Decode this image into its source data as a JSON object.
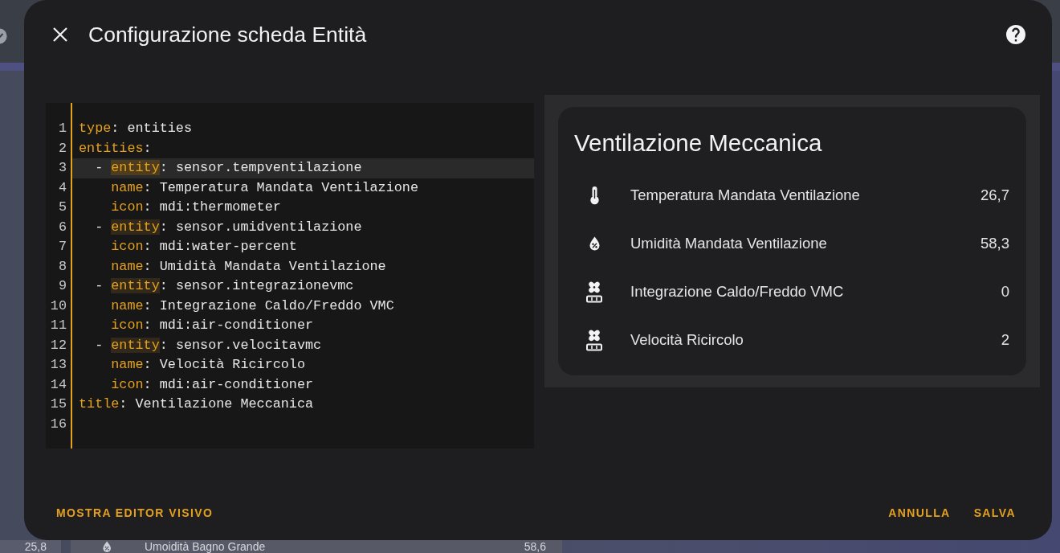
{
  "dashboard": {
    "side_value": "25,8",
    "row": {
      "kind": "humidity",
      "name": "Umoidità Bagno Grande",
      "value": "58,6"
    }
  },
  "dialog": {
    "title": "Configurazione scheda Entità",
    "editor": {
      "lines": [
        {
          "number": "1",
          "active": false,
          "tokens": [
            {
              "kind": "key",
              "text": "type",
              "matched": false
            },
            {
              "kind": "plain",
              "text": ": entities"
            }
          ]
        },
        {
          "number": "2",
          "active": false,
          "tokens": [
            {
              "kind": "key",
              "text": "entities",
              "matched": false
            },
            {
              "kind": "plain",
              "text": ":"
            }
          ],
          "children": [
            {
              "number": "3",
              "active": true,
              "tokens": [
                {
                  "kind": "plain",
                  "text": "- "
                },
                {
                  "kind": "key",
                  "text": "entity",
                  "matched": true
                },
                {
                  "kind": "plain",
                  "text": ": sensor.tempventilazione"
                }
              ],
              "children": [
                {
                  "number": "4",
                  "active": false,
                  "tokens": [
                    {
                      "kind": "key",
                      "text": "name",
                      "matched": false
                    },
                    {
                      "kind": "plain",
                      "text": ": Temperatura Mandata Ventilazione"
                    }
                  ]
                },
                {
                  "number": "5",
                  "active": false,
                  "tokens": [
                    {
                      "kind": "key",
                      "text": "icon",
                      "matched": false
                    },
                    {
                      "kind": "plain",
                      "text": ": mdi:thermometer"
                    }
                  ]
                }
              ]
            },
            {
              "number": "6",
              "active": false,
              "tokens": [
                {
                  "kind": "plain",
                  "text": "- "
                },
                {
                  "kind": "key",
                  "text": "entity",
                  "matched": true
                },
                {
                  "kind": "plain",
                  "text": ": sensor.umidventilazione"
                }
              ],
              "children": [
                {
                  "number": "7",
                  "active": false,
                  "tokens": [
                    {
                      "kind": "key",
                      "text": "icon",
                      "matched": false
                    },
                    {
                      "kind": "plain",
                      "text": ": mdi:water-percent"
                    }
                  ]
                },
                {
                  "number": "8",
                  "active": false,
                  "tokens": [
                    {
                      "kind": "key",
                      "text": "name",
                      "matched": false
                    },
                    {
                      "kind": "plain",
                      "text": ": Umidità Mandata Ventilazione"
                    }
                  ]
                }
              ]
            },
            {
              "number": "9",
              "active": false,
              "tokens": [
                {
                  "kind": "plain",
                  "text": "- "
                },
                {
                  "kind": "key",
                  "text": "entity",
                  "matched": true
                },
                {
                  "kind": "plain",
                  "text": ": sensor.integrazionevmc"
                }
              ],
              "children": [
                {
                  "number": "10",
                  "active": false,
                  "tokens": [
                    {
                      "kind": "key",
                      "text": "name",
                      "matched": false
                    },
                    {
                      "kind": "plain",
                      "text": ": Integrazione Caldo/Freddo VMC"
                    }
                  ]
                },
                {
                  "number": "11",
                  "active": false,
                  "tokens": [
                    {
                      "kind": "key",
                      "text": "icon",
                      "matched": false
                    },
                    {
                      "kind": "plain",
                      "text": ": mdi:air-conditioner"
                    }
                  ]
                }
              ]
            },
            {
              "number": "12",
              "active": false,
              "tokens": [
                {
                  "kind": "plain",
                  "text": "- "
                },
                {
                  "kind": "key",
                  "text": "entity",
                  "matched": true
                },
                {
                  "kind": "plain",
                  "text": ": sensor.velocitavmc"
                }
              ],
              "children": [
                {
                  "number": "13",
                  "active": false,
                  "tokens": [
                    {
                      "kind": "key",
                      "text": "name",
                      "matched": false
                    },
                    {
                      "kind": "plain",
                      "text": ": Velocità Ricircolo"
                    }
                  ]
                },
                {
                  "number": "14",
                  "active": false,
                  "tokens": [
                    {
                      "kind": "key",
                      "text": "icon",
                      "matched": false
                    },
                    {
                      "kind": "plain",
                      "text": ": mdi:air-conditioner"
                    }
                  ]
                }
              ]
            }
          ]
        },
        {
          "number": "15",
          "active": false,
          "tokens": [
            {
              "kind": "key",
              "text": "title",
              "matched": false
            },
            {
              "kind": "plain",
              "text": ": Ventilazione Meccanica"
            }
          ]
        },
        {
          "number": "16",
          "active": false
        }
      ]
    },
    "preview": {
      "title": "Ventilazione Meccanica",
      "rows": [
        {
          "kind": "temperature",
          "name": "Temperatura Mandata Ventilazione",
          "value": "26,7"
        },
        {
          "kind": "humidity",
          "name": "Umidità Mandata Ventilazione",
          "value": "58,3"
        },
        {
          "kind": "hvac",
          "name": "Integrazione Caldo/Freddo VMC",
          "value": "0"
        },
        {
          "kind": "hvac",
          "name": "Velocità Ricircolo",
          "value": "2"
        }
      ]
    },
    "footer": {
      "left_button": "MOSTRA EDITOR VISIVO",
      "right_buttons": [
        "ANNULLA",
        "SALVA"
      ]
    }
  }
}
